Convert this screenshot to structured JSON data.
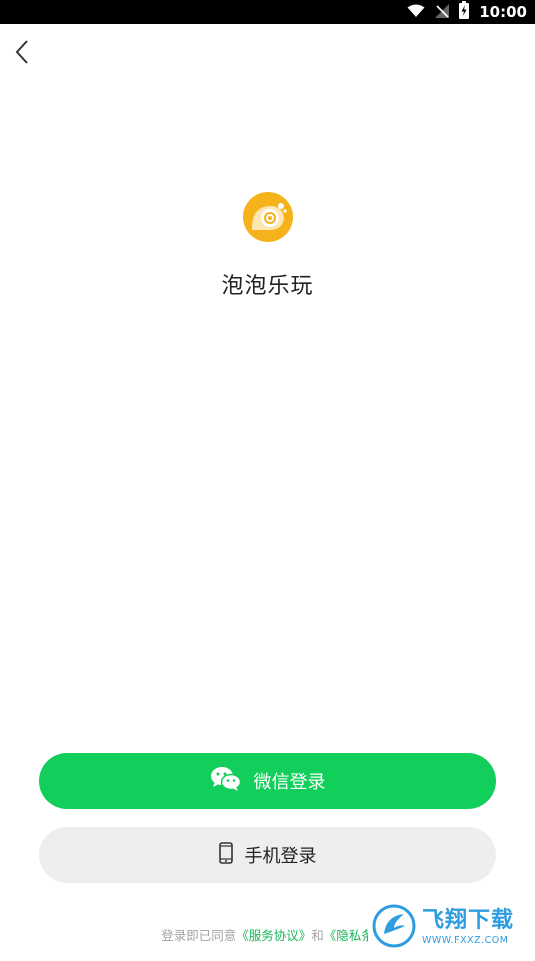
{
  "status_bar": {
    "time": "10:00"
  },
  "app": {
    "name": "泡泡乐玩"
  },
  "buttons": {
    "wechat_login": "微信登录",
    "phone_login": "手机登录"
  },
  "agreement": {
    "prefix": "登录即已同意",
    "service_link": "《服务协议》",
    "conjunction": "和",
    "privacy_link": "《隐私条"
  },
  "watermark": {
    "title": "飞翔下载",
    "url": "WWW.FXXZ.COM"
  },
  "colors": {
    "wechat_green": "#12CE5A",
    "link_green": "#17B656",
    "logo_yellow": "#F5B21A",
    "watermark_blue": "#2E9CE0"
  },
  "icons": {
    "back": "chevron-left-icon",
    "wechat": "wechat-icon",
    "phone": "smartphone-icon",
    "wifi": "wifi-icon",
    "signal": "no-signal-icon",
    "battery": "battery-charging-icon"
  }
}
